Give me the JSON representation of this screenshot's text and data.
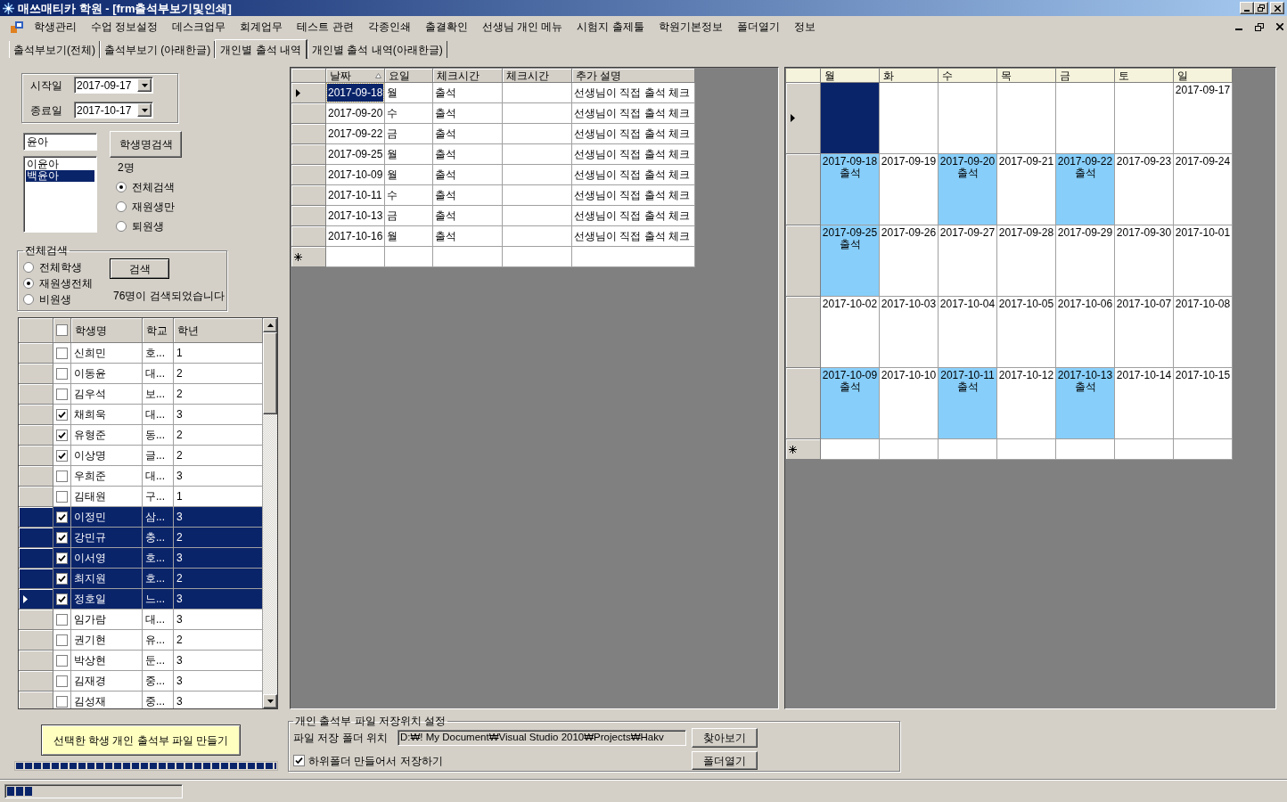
{
  "window": {
    "title": "매쓰매티카 학원 - [frm출석부보기및인쇄]"
  },
  "menu": [
    "학생관리",
    "수업 정보설정",
    "데스크업무",
    "회계업무",
    "테스트 관련",
    "각종인쇄",
    "출결확인",
    "선생님 개인 메뉴",
    "시험지 출제툴",
    "학원기본정보",
    "폴더열기",
    "정보"
  ],
  "tabs": [
    {
      "label": "출석부보기(전체)",
      "selected": false
    },
    {
      "label": "출석부보기 (아래한글)",
      "selected": false
    },
    {
      "label": "개인별 출석 내역",
      "selected": true
    },
    {
      "label": "개인별 출석 내역(아래한글)",
      "selected": false
    }
  ],
  "date_range": [
    {
      "label": "시작일",
      "value": "2017-09-17"
    },
    {
      "label": "종료일",
      "value": "2017-10-17"
    }
  ],
  "name_search": {
    "value": "윤아",
    "button": "학생명검색",
    "results": [
      {
        "name": "이윤아",
        "selected": false
      },
      {
        "name": "백윤아",
        "selected": true
      }
    ],
    "count": "2명",
    "filters": [
      {
        "label": "전체검색",
        "selected": true
      },
      {
        "label": "재원생만",
        "selected": false
      },
      {
        "label": "퇴원생",
        "selected": false
      }
    ]
  },
  "all_search": {
    "title": "전체검색",
    "options": [
      {
        "label": "전체학생",
        "selected": false
      },
      {
        "label": "재원생전체",
        "selected": true
      },
      {
        "label": "비원생",
        "selected": false
      }
    ],
    "button": "검색",
    "result": "76명이 검색되었습니다"
  },
  "student_grid": {
    "all_checked": false,
    "columns": [
      "학생명",
      "학교",
      "학년"
    ],
    "rows": [
      {
        "name": "신희민",
        "school": "호...",
        "grade": "1",
        "checked": false,
        "selected": false,
        "current": false
      },
      {
        "name": "이동윤",
        "school": "대...",
        "grade": "2",
        "checked": false,
        "selected": false,
        "current": false
      },
      {
        "name": "김우석",
        "school": "보...",
        "grade": "2",
        "checked": false,
        "selected": false,
        "current": false
      },
      {
        "name": "채희욱",
        "school": "대...",
        "grade": "3",
        "checked": true,
        "selected": false,
        "current": false
      },
      {
        "name": "유형준",
        "school": "동...",
        "grade": "2",
        "checked": true,
        "selected": false,
        "current": false
      },
      {
        "name": "이상명",
        "school": "글...",
        "grade": "2",
        "checked": true,
        "selected": false,
        "current": false
      },
      {
        "name": "우희준",
        "school": "대...",
        "grade": "3",
        "checked": false,
        "selected": false,
        "current": false
      },
      {
        "name": "김태원",
        "school": "구...",
        "grade": "1",
        "checked": false,
        "selected": false,
        "current": false
      },
      {
        "name": "이정민",
        "school": "삼...",
        "grade": "3",
        "checked": true,
        "selected": true,
        "current": false
      },
      {
        "name": "강민규",
        "school": "충...",
        "grade": "2",
        "checked": true,
        "selected": true,
        "current": false
      },
      {
        "name": "이서영",
        "school": "호...",
        "grade": "3",
        "checked": true,
        "selected": true,
        "current": false
      },
      {
        "name": "최지원",
        "school": "호...",
        "grade": "2",
        "checked": true,
        "selected": true,
        "current": false
      },
      {
        "name": "정호일",
        "school": "느...",
        "grade": "3",
        "checked": true,
        "selected": true,
        "current": true
      },
      {
        "name": "임가람",
        "school": "대...",
        "grade": "3",
        "checked": false,
        "selected": false,
        "current": false
      },
      {
        "name": "권기현",
        "school": "유...",
        "grade": "2",
        "checked": false,
        "selected": false,
        "current": false
      },
      {
        "name": "박상현",
        "school": "둔...",
        "grade": "3",
        "checked": false,
        "selected": false,
        "current": false
      },
      {
        "name": "김재경",
        "school": "중...",
        "grade": "3",
        "checked": false,
        "selected": false,
        "current": false
      },
      {
        "name": "김성재",
        "school": "중...",
        "grade": "3",
        "checked": false,
        "selected": false,
        "current": false
      }
    ]
  },
  "create_button": "선택한 학생 개인 출석부 파일 만들기",
  "create_progress": {
    "level": 1
  },
  "attendance_grid": {
    "columns": [
      {
        "label": "날짜",
        "sorted": true
      },
      {
        "label": "요일",
        "sorted": false
      },
      {
        "label": "체크시간",
        "sorted": false
      },
      {
        "label": "체크시간",
        "sorted": false
      },
      {
        "label": "추가 설명",
        "sorted": false
      }
    ],
    "rows": [
      {
        "date": "2017-09-18",
        "weekday": "월",
        "check_time": "출석",
        "note": "선생님이 직접 출석 체크",
        "current": true,
        "selected": true
      },
      {
        "date": "2017-09-20",
        "weekday": "수",
        "check_time": "출석",
        "note": "선생님이 직접 출석 체크",
        "current": false,
        "selected": false
      },
      {
        "date": "2017-09-22",
        "weekday": "금",
        "check_time": "출석",
        "note": "선생님이 직접 출석 체크",
        "current": false,
        "selected": false
      },
      {
        "date": "2017-09-25",
        "weekday": "월",
        "check_time": "출석",
        "note": "선생님이 직접 출석 체크",
        "current": false,
        "selected": false
      },
      {
        "date": "2017-10-09",
        "weekday": "월",
        "check_time": "출석",
        "note": "선생님이 직접 출석 체크",
        "current": false,
        "selected": false
      },
      {
        "date": "2017-10-11",
        "weekday": "수",
        "check_time": "출석",
        "note": "선생님이 직접 출석 체크",
        "current": false,
        "selected": false
      },
      {
        "date": "2017-10-13",
        "weekday": "금",
        "check_time": "출석",
        "note": "선생님이 직접 출석 체크",
        "current": false,
        "selected": false
      },
      {
        "date": "2017-10-16",
        "weekday": "월",
        "check_time": "출석",
        "note": "선생님이 직접 출석 체크",
        "current": false,
        "selected": false
      }
    ],
    "new_row": true
  },
  "calendar": {
    "columns": [
      "월",
      "화",
      "수",
      "목",
      "금",
      "토",
      "일"
    ],
    "weeks": [
      {
        "current": true,
        "days": [
          {
            "selected": true
          },
          {
            "selected": false
          },
          {
            "selected": false
          },
          {
            "selected": false
          },
          {
            "selected": false
          },
          {
            "selected": false
          },
          {
            "date": "2017-09-17",
            "selected": false
          }
        ]
      },
      {
        "current": false,
        "days": [
          {
            "date": "2017-09-18",
            "status": "출석",
            "color": "#87cefa",
            "selected": false
          },
          {
            "date": "2017-09-19",
            "selected": false
          },
          {
            "date": "2017-09-20",
            "status": "출석",
            "color": "#87cefa",
            "selected": false
          },
          {
            "date": "2017-09-21",
            "selected": false
          },
          {
            "date": "2017-09-22",
            "status": "출석",
            "color": "#87cefa",
            "selected": false
          },
          {
            "date": "2017-09-23",
            "selected": false
          },
          {
            "date": "2017-09-24",
            "selected": false
          }
        ]
      },
      {
        "current": false,
        "days": [
          {
            "date": "2017-09-25",
            "status": "출석",
            "color": "#87cefa",
            "selected": false
          },
          {
            "date": "2017-09-26",
            "selected": false
          },
          {
            "date": "2017-09-27",
            "selected": false
          },
          {
            "date": "2017-09-28",
            "selected": false
          },
          {
            "date": "2017-09-29",
            "selected": false
          },
          {
            "date": "2017-09-30",
            "selected": false
          },
          {
            "date": "2017-10-01",
            "selected": false
          }
        ]
      },
      {
        "current": false,
        "days": [
          {
            "date": "2017-10-02",
            "selected": false
          },
          {
            "date": "2017-10-03",
            "selected": false
          },
          {
            "date": "2017-10-04",
            "selected": false
          },
          {
            "date": "2017-10-05",
            "selected": false
          },
          {
            "date": "2017-10-06",
            "selected": false
          },
          {
            "date": "2017-10-07",
            "selected": false
          },
          {
            "date": "2017-10-08",
            "selected": false
          }
        ]
      },
      {
        "current": false,
        "days": [
          {
            "date": "2017-10-09",
            "status": "출석",
            "color": "#87cefa",
            "selected": false
          },
          {
            "date": "2017-10-10",
            "selected": false
          },
          {
            "date": "2017-10-11",
            "status": "출석",
            "color": "#87cefa",
            "selected": false
          },
          {
            "date": "2017-10-12",
            "selected": false
          },
          {
            "date": "2017-10-13",
            "status": "출석",
            "color": "#87cefa",
            "selected": false
          },
          {
            "date": "2017-10-14",
            "selected": false
          },
          {
            "date": "2017-10-15",
            "selected": false
          }
        ]
      }
    ],
    "new_row": true
  },
  "save_settings": {
    "title": "개인 출석부 파일 저장위치 설정",
    "folder_label": "파일 저장 폴더 위치",
    "folder_path": "D:₩! My Document₩Visual Studio 2010₩Projects₩Hakv",
    "browse_button": "찾아보기",
    "subfolder": {
      "label": "하위폴더 만들어서 저장하기",
      "checked": true
    },
    "open_button": "폴더열기"
  },
  "status_bar": {
    "progress": {
      "level": 0.15
    }
  }
}
